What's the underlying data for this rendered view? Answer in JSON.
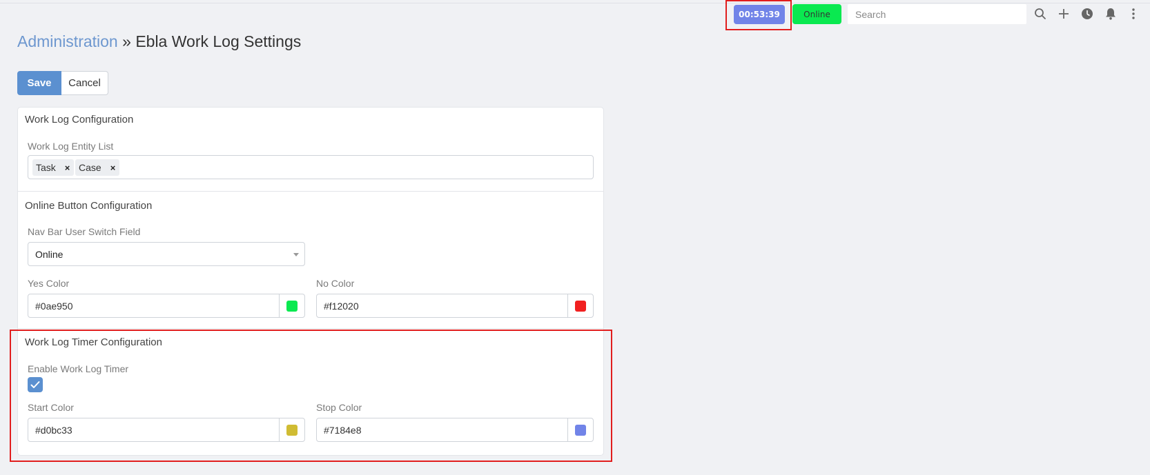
{
  "colors": {
    "timer": "#7184e8",
    "online": "#0ae950",
    "accent": "#5b90d0",
    "link": "#6d97cf",
    "highlight": "#e11d1d"
  },
  "navbar": {
    "timer_label": "00:53:39",
    "online_label": "Online",
    "search_placeholder": "Search",
    "icons": [
      "search-icon",
      "plus-icon",
      "clock-icon",
      "bell-icon",
      "more-vertical-icon"
    ]
  },
  "breadcrumb": {
    "parent": "Administration",
    "separator": "»",
    "current": "Ebla Work Log Settings"
  },
  "actions": {
    "save": "Save",
    "cancel": "Cancel"
  },
  "work_log_config": {
    "title": "Work Log Configuration",
    "entity_list_label": "Work Log Entity List",
    "entity_tags": [
      "Task",
      "Case"
    ]
  },
  "online_button_config": {
    "title": "Online Button Configuration",
    "switch_field_label": "Nav Bar User Switch Field",
    "switch_field_value": "Online",
    "yes_color_label": "Yes Color",
    "yes_color_value": "#0ae950",
    "no_color_label": "No Color",
    "no_color_value": "#f12020"
  },
  "timer_config": {
    "title": "Work Log Timer Configuration",
    "enable_label": "Enable Work Log Timer",
    "enabled": true,
    "start_color_label": "Start Color",
    "start_color_value": "#d0bc33",
    "stop_color_label": "Stop Color",
    "stop_color_value": "#7184e8"
  }
}
